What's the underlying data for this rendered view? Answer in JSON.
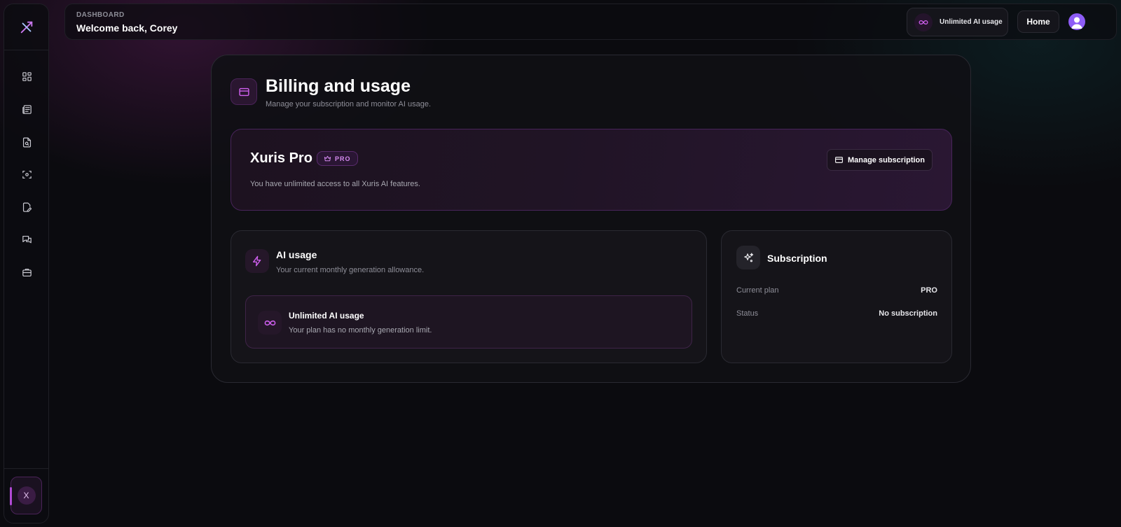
{
  "header": {
    "kicker": "DASHBOARD",
    "welcome": "Welcome back, Corey",
    "usage_pill": "Unlimited AI usage",
    "home_label": "Home"
  },
  "sidebar": {
    "items": [
      {
        "name": "dashboard",
        "icon": "grid-icon"
      },
      {
        "name": "documents",
        "icon": "newspaper-icon"
      },
      {
        "name": "search-docs",
        "icon": "file-search-icon"
      },
      {
        "name": "scan",
        "icon": "scan-icon"
      },
      {
        "name": "edit",
        "icon": "file-edit-icon"
      },
      {
        "name": "chat",
        "icon": "chat-icon"
      },
      {
        "name": "jobs",
        "icon": "briefcase-icon"
      }
    ],
    "user_initial": "X"
  },
  "page": {
    "title": "Billing and usage",
    "subtitle": "Manage your subscription and monitor AI usage."
  },
  "plan": {
    "name": "Xuris Pro",
    "badge": "PRO",
    "description": "You have unlimited access to all Xuris AI features.",
    "manage_label": "Manage subscription"
  },
  "usage": {
    "title": "AI usage",
    "subtitle": "Your current monthly generation allowance.",
    "box_title": "Unlimited AI usage",
    "box_subtitle": "Your plan has no monthly generation limit."
  },
  "subscription": {
    "title": "Subscription",
    "rows": [
      {
        "label": "Current plan",
        "value": "PRO"
      },
      {
        "label": "Status",
        "value": "No subscription"
      }
    ]
  },
  "colors": {
    "accent": "#b24ad6",
    "accent_light": "#d58af0",
    "avatar": "#8d5cf6"
  }
}
